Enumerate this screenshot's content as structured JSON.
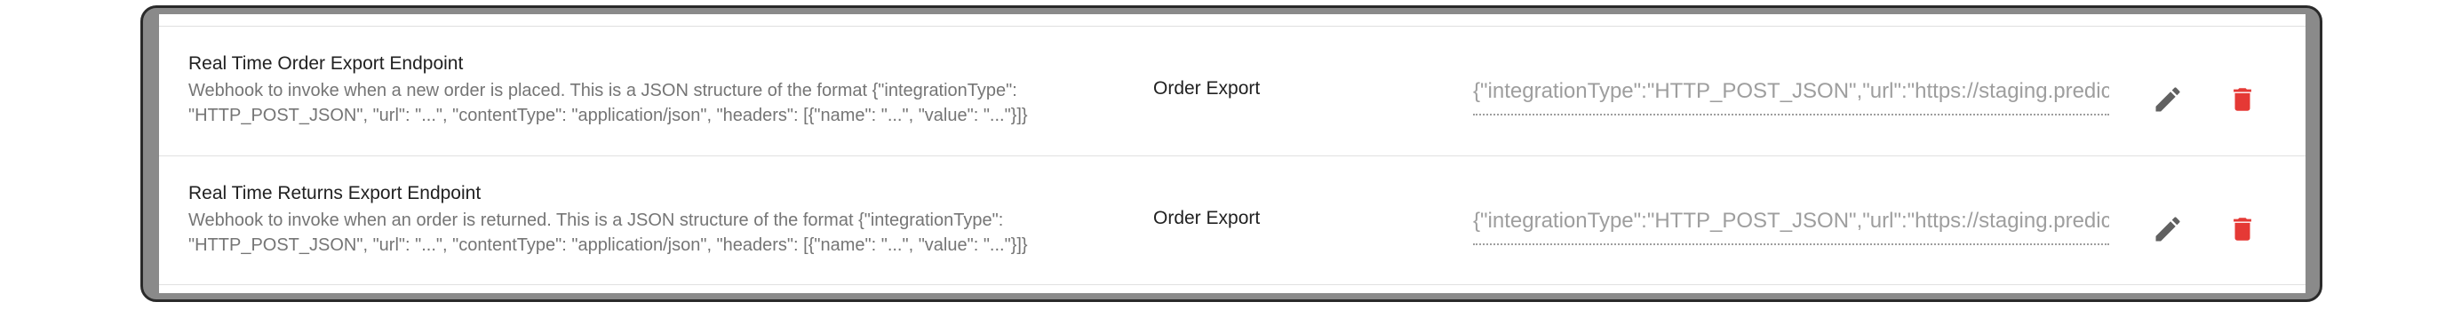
{
  "settings": [
    {
      "name": "Real Time Order Export Endpoint",
      "description": "Webhook to invoke when a new order is placed. This is a JSON structure of the format {\"integrationType\": \"HTTP_POST_JSON\", \"url\": \"...\", \"contentType\": \"application/json\", \"headers\": [{\"name\": \"...\", \"value\": \"...\"}]}",
      "group": "Order Export",
      "value": "{\"integrationType\":\"HTTP_POST_JSON\",\"url\":\"https://staging.predic"
    },
    {
      "name": "Real Time Returns Export Endpoint",
      "description": "Webhook to invoke when an order is returned. This is a JSON structure of the format {\"integrationType\": \"HTTP_POST_JSON\", \"url\": \"...\", \"contentType\": \"application/json\", \"headers\": [{\"name\": \"...\", \"value\": \"...\"}]}",
      "group": "Order Export",
      "value": "{\"integrationType\":\"HTTP_POST_JSON\",\"url\":\"https://staging.predic"
    }
  ],
  "icons": {
    "edit": "pencil-icon",
    "delete": "trash-icon"
  },
  "colors": {
    "delete": "#e53935",
    "edit": "#616161",
    "frame": "#8a8a8a"
  }
}
